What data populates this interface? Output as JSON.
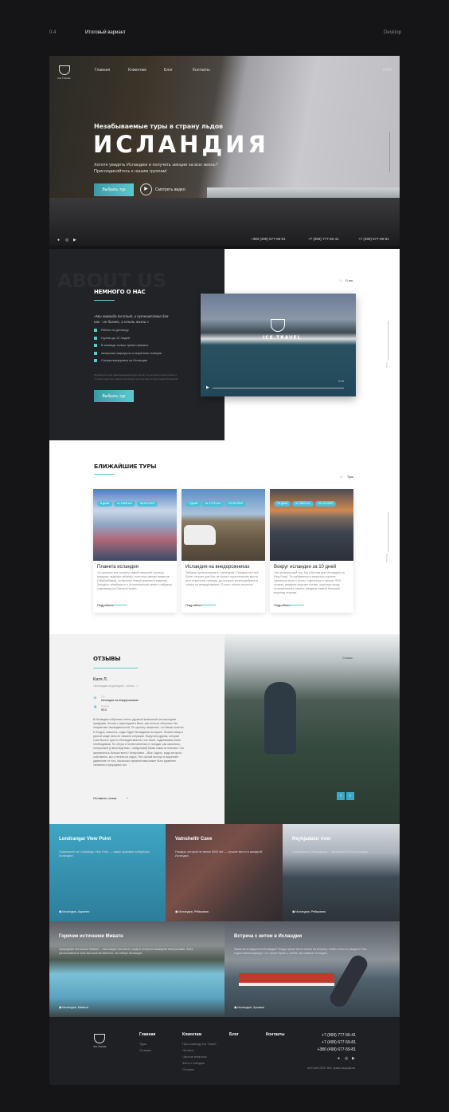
{
  "topbar": {
    "number": "0.4",
    "title": "Итоговый вариант",
    "device": "Desktop"
  },
  "hero": {
    "logo_text": "ICE TRAVEL",
    "nav": [
      "Главная",
      "Клиентам",
      "Блог",
      "Контакты"
    ],
    "lang": "ENG",
    "subtitle": "Незабываемые туры в страну льдов",
    "title": "ИСЛАНДИЯ",
    "text": "Хотите увидеть Исландию и получить эмоции на всю жизнь? Присоединяйтесь к нашим группам!",
    "cta": "Выбрать тур",
    "video": "Смотреть видео",
    "phones": [
      "+380 (499) 677-59-81",
      "+7 (969) 777-56-41",
      "+7 (499) 677-59-81"
    ],
    "socials": [
      "facebook-icon",
      "instagram-icon",
      "youtube-icon"
    ]
  },
  "about": {
    "bg_word": "ABOUT US",
    "heading": "НЕМНОГО О НАС",
    "quote": "«Мы команда Ice.travel, и путешествия для нас - не бизнес, а стиль жизни.»",
    "list": [
      "Работа по договору",
      "Группы до 12 людей",
      "В команде только тревел фанаты",
      "Авторские маршруты и секретные локации",
      "Специализируемся на Исландии"
    ],
    "note": "Посмотрите наш замечательный видео-ролик, он детально опишет вам то, что вам предстоит увидеть во время путешествия по просторам Исландии!",
    "cta": "Выбрать тур",
    "section_index": "01",
    "section_label": "О нас",
    "video_brand": "ICE.TRAVEL",
    "video_time": "0:43",
    "side_label": "Туры"
  },
  "tours": {
    "heading": "БЛИЖАЙШИЕ ТУРЫ",
    "section_index": "02",
    "section_label": "Туры",
    "side_label": "Отзывы",
    "more": "Подробнее",
    "cards": [
      {
        "badges": [
          "8 дней",
          "от 1089 eur",
          "05.09.2020"
        ],
        "title": "Планета исландия",
        "text": "Ты узнаешь все секреты самой северной столицы, увидишь ледяные гейзеры, посетишь ферму викингов (Эйрбинбакки), услышишь самый красивый водопад Эрьуфоз, влюбишься в Атлантический океан и найдешь сокровища на Diamond beach."
      },
      {
        "badges": [
          "7 дней",
          "от 1775 eur",
          "15.09.2020"
        ],
        "title": "Исландия на внедорожниках",
        "text": "Любишь путешествовать с ветерком? Поездка на Land Rover откроет для Вас не только туристические места, но и секретные локации, до которых можно добраться только на внедорожниках. Стоить только захотеть!"
      },
      {
        "badges": [
          "10 дней",
          "от 2800 eur",
          "02.10.2020"
        ],
        "title": "Вокруг исландии за 10 дней",
        "text": "Это флагманский тур. Мы обогнем всю Исландию по Ring Road. Ты побываешь в закрытых порогах, сделаешь фото с китом, отдохнешь в лучших SPA страны, увидишь морские котики, ощутишь мощь атлантического океана, увидишь самый большой водопад острова."
      }
    ]
  },
  "reviews": {
    "heading": "ОТЗЫВЫ",
    "name": "Катя Л.",
    "tagline": "«Исландию когда видеть, понять...»",
    "tour_label": "Тур",
    "tour_value": "Исландия на внедорожниках",
    "rating_label": "Оценка",
    "rating_value": "9/10",
    "text": "В Исландию собрались лететь дружной компанией на новогодние праздники. Летели с пересадкой в Вене, при этом не обошлось без неприятных неожиданностей. По прилету оказалось, что багаж полетел в Лондон, казалось, отдых будет безнадежно испорчен. Личные вещи в ручной кладе явно не спасали ситуацию. Выручили друзья, которые тоже были в туре по Исландии вместе с Ice.travel, поделившись всем необходимым. Но отпуск и на впечатления от поездки, как оказалось, потерянный (и впоследствии – найденный) багаж никак не повлиял. Что запомнилось больше всего? Безусловно – Blue Lagoon, воды которого, собственно, мы и летели на отдых. Это чистый восторг и искреннее удивление от того, насколько гармоничным может быть единение человека и природных сил.",
    "leave": "Оставить отзыв",
    "section_index": "03",
    "section_label": "Отзывы"
  },
  "gallery": [
    {
      "title": "Londrangar View Point",
      "text": "Посмотрите на Londrangar View Point — самое красивое побережье Исландии!",
      "location": "Исландия, Акранес"
    },
    {
      "title": "Vatnshellir Cave",
      "text": "Пещера, которой не менее 8000 лет — лучшее место в западной Исландии",
      "location": "Исландия, Рейкьявик"
    },
    {
      "title": "Reykjadalur river",
      "text": "Горячая река Рейкьядалур – настоящее SPA в Исландии",
      "location": "Исландия, Рейкьявик"
    },
    {
      "title": "Горячие источники Миватн",
      "text": "Природные источники Миватн – настоящее спа-место, вода в котором насыщена минералами. Зона расположена в зоне высокой активности, на севере Исландии.",
      "location": "Исландия, Миватн"
    },
    {
      "title": "Встреча с китом в Исландии",
      "text": "Какие киты водятся в Исландии? Когда лучше всего плыть на встречу, чтобы точно их увидеть? Мы подготовили маршрут, что нужно брать с собой, как снимать на видео.",
      "location": "Исландия, Хусавик"
    }
  ],
  "footer": {
    "logo_text": "ICE TRAVEL",
    "cols": [
      {
        "title": "Главная",
        "links": [
          "Туры",
          "Отзывы"
        ]
      },
      {
        "title": "Клиентам",
        "links": [
          "Про команду Ice Travel",
          "Оплата",
          "Частые вопросы",
          "Фото с поездок",
          "Отзывы"
        ]
      },
      {
        "title": "Блог",
        "links": []
      },
      {
        "title": "Контакты",
        "links": []
      }
    ],
    "phones": [
      "+7 (969) 777-56-41",
      "+7 (499) 677-59-81",
      "+380 (499) 677-59-81"
    ],
    "copyright": "IceTravel 2020. Все права защищены."
  },
  "colors": {
    "accent": "#5cc9cf",
    "dark": "#1f2023",
    "page": "#151517"
  }
}
